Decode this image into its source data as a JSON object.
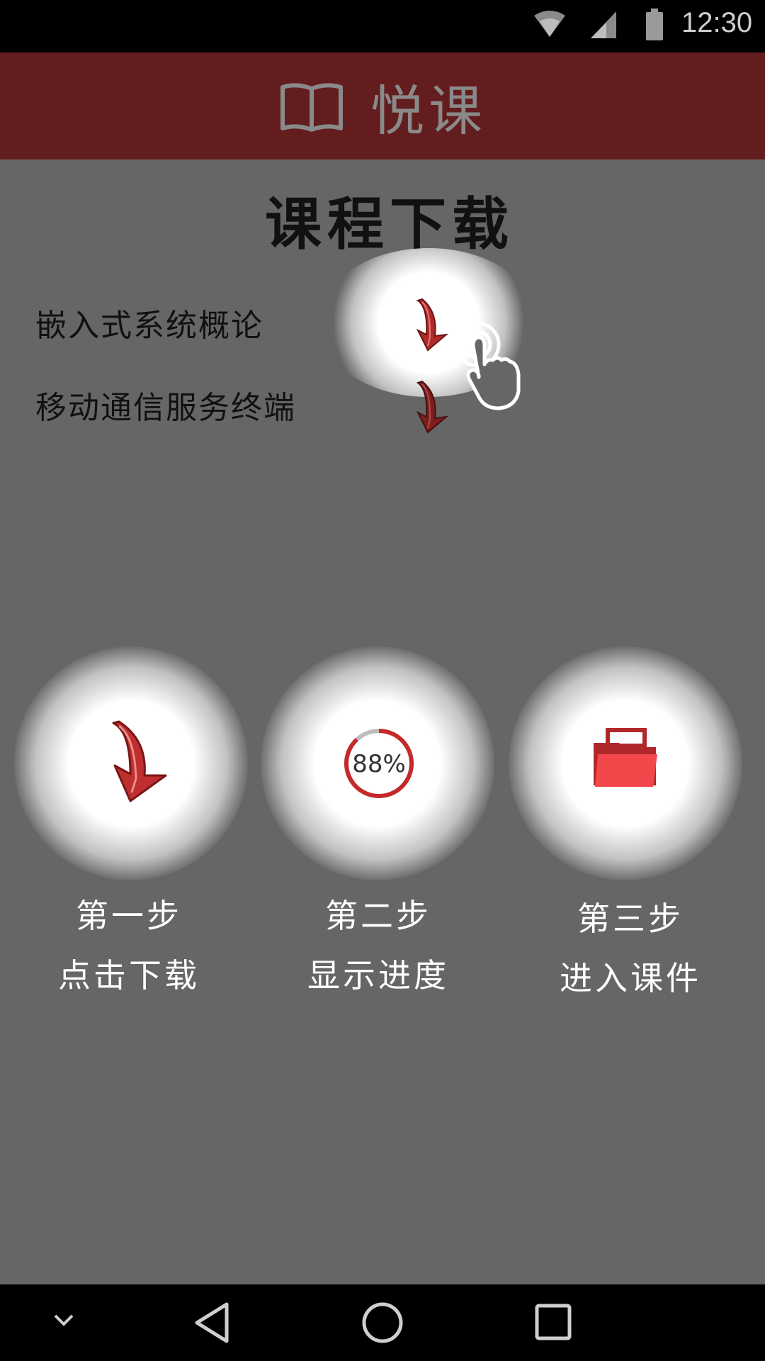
{
  "status_bar": {
    "time": "12:30",
    "icons": [
      "wifi-icon",
      "signal-icon",
      "battery-icon"
    ]
  },
  "app_bar": {
    "title": "悦课",
    "icon": "book-icon",
    "background": "#631d1e"
  },
  "page": {
    "title": "课程下载"
  },
  "courses": [
    {
      "name": "嵌入式系统概论",
      "action_icon": "download-arrow-icon"
    },
    {
      "name": "移动通信服务终端",
      "action_icon": "download-arrow-icon"
    }
  ],
  "tutorial_icon": "tap-hand-icon",
  "steps": [
    {
      "step": "第一步",
      "desc": "点击下载",
      "icon": "download-arrow-icon"
    },
    {
      "step": "第二步",
      "desc": "显示进度",
      "icon": "progress-ring-icon",
      "progress_text": "88%",
      "progress": 0.88
    },
    {
      "step": "第三步",
      "desc": "进入课件",
      "icon": "folder-icon"
    }
  ],
  "nav_bar": {
    "icons": [
      "hide-keyboard-icon",
      "back-icon",
      "home-icon",
      "recents-icon"
    ]
  },
  "colors": {
    "accent": "#c42a2a",
    "overlay": "#666666"
  }
}
